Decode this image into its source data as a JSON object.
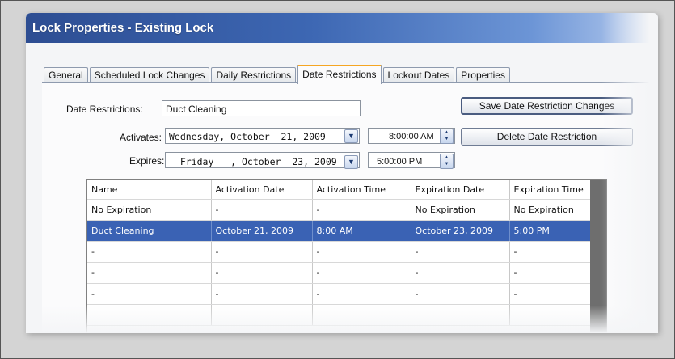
{
  "window": {
    "title": "Lock Properties - Existing Lock"
  },
  "tabs": [
    {
      "label": "General"
    },
    {
      "label": "Scheduled Lock Changes"
    },
    {
      "label": "Daily Restrictions"
    },
    {
      "label": "Date Restrictions"
    },
    {
      "label": "Lockout Dates"
    },
    {
      "label": "Properties"
    }
  ],
  "form": {
    "name_label": "Date Restrictions:",
    "name_value": "Duct Cleaning",
    "activates_label": "Activates:",
    "activates_date": "Wednesday, October  21, 2009",
    "activates_time": "8:00:00 AM",
    "expires_label": "Expires:",
    "expires_date": "  Friday   , October  23, 2009",
    "expires_time": "5:00:00 PM"
  },
  "buttons": {
    "save": "Save Date Restriction Changes",
    "delete": "Delete Date Restriction"
  },
  "grid": {
    "columns": [
      "Name",
      "Activation Date",
      "Activation Time",
      "Expiration Date",
      "Expiration Time"
    ],
    "rows": [
      [
        "No Expiration",
        "-",
        "-",
        "No Expiration",
        "No Expiration"
      ],
      [
        "Duct Cleaning",
        "October 21, 2009",
        "8:00 AM",
        "October 23, 2009",
        "5:00 PM"
      ],
      [
        "-",
        "-",
        "-",
        "-",
        "-"
      ],
      [
        "-",
        "-",
        "-",
        "-",
        "-"
      ],
      [
        "-",
        "-",
        "-",
        "-",
        "-"
      ],
      [
        "",
        "",
        "",
        "",
        ""
      ]
    ],
    "selected_row": 1
  },
  "colors": {
    "title_bar": "#3d67b3",
    "selection": "#3a62b4",
    "active_tab_accent": "#f5a623"
  },
  "icons": {
    "dropdown": "chevron-down-icon",
    "spinner": "up-down-spinner-icon"
  }
}
